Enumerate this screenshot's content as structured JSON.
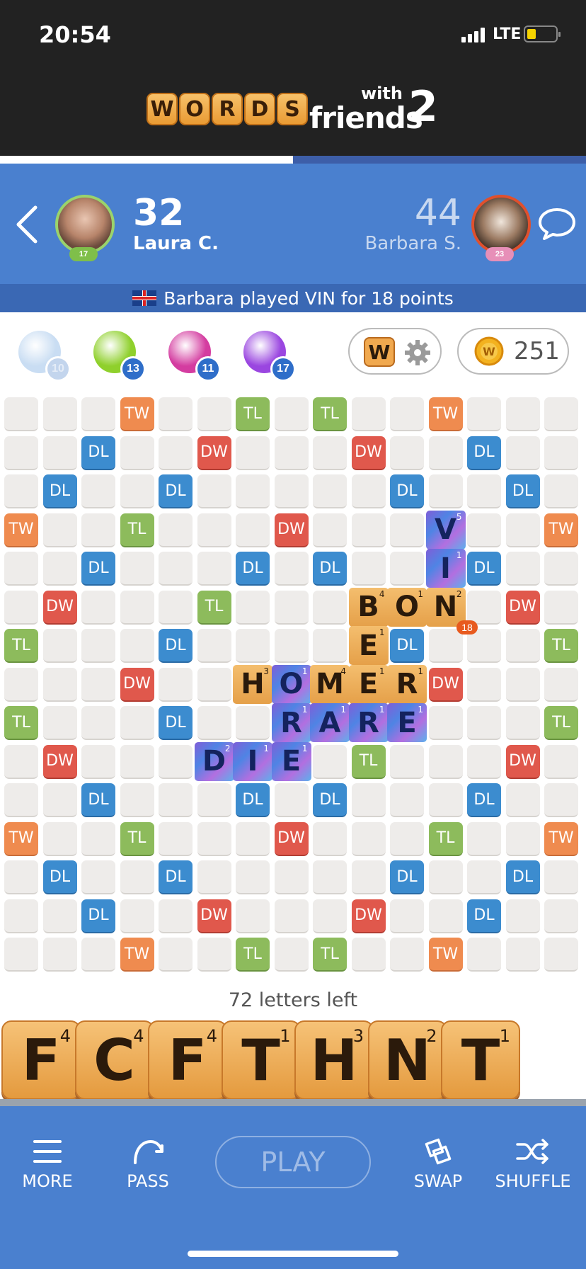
{
  "status": {
    "time": "20:54",
    "network": "LTE"
  },
  "logo": {
    "letters": [
      "W",
      "O",
      "R",
      "D",
      "S"
    ],
    "with": "with",
    "friends": "friends",
    "two": "2"
  },
  "match_progress": 0.5,
  "player": {
    "score": "32",
    "name": "Laura  C.",
    "level": "17"
  },
  "opponent": {
    "score": "44",
    "name": "Barbara S.",
    "level": "23"
  },
  "last_play": "Barbara played VIN for 18 points",
  "powerups": [
    {
      "name": "hindsight-icon",
      "count": "10",
      "color": "#b7d2ef"
    },
    {
      "name": "word-radar-icon",
      "count": "13",
      "color": "#8fd02c"
    },
    {
      "name": "swap-plus-icon",
      "count": "11",
      "color": "#d43ca0"
    },
    {
      "name": "word-strength-icon",
      "count": "17",
      "color": "#9a46e0"
    }
  ],
  "settings_pill": {
    "letter": "W"
  },
  "coins": "251",
  "board": {
    "bonus_rows": [
      [
        "",
        "",
        "",
        "TW",
        "",
        "",
        "TL",
        "",
        "TL",
        "",
        "",
        "TW",
        "",
        "",
        ""
      ],
      [
        "",
        "",
        "DL",
        "",
        "",
        "DW",
        "",
        "",
        "",
        "DW",
        "",
        "",
        "DL",
        "",
        ""
      ],
      [
        "",
        "DL",
        "",
        "",
        "DL",
        "",
        "",
        "",
        "",
        "",
        "DL",
        "",
        "",
        "DL",
        ""
      ],
      [
        "TW",
        "",
        "",
        "TL",
        "",
        "",
        "",
        "DW",
        "",
        "",
        "",
        "",
        "",
        "",
        "TW"
      ],
      [
        "",
        "",
        "DL",
        "",
        "",
        "",
        "DL",
        "",
        "DL",
        "",
        "",
        "",
        "DL",
        "",
        ""
      ],
      [
        "",
        "DW",
        "",
        "",
        "",
        "TL",
        "",
        "",
        "",
        "",
        "",
        "",
        "",
        "DW",
        ""
      ],
      [
        "TL",
        "",
        "",
        "",
        "DL",
        "",
        "",
        "",
        "",
        "",
        "DL",
        "",
        "",
        "",
        "TL"
      ],
      [
        "",
        "",
        "",
        "DW",
        "",
        "",
        "",
        "",
        "",
        "",
        "",
        "DW",
        "",
        "",
        ""
      ],
      [
        "TL",
        "",
        "",
        "",
        "DL",
        "",
        "",
        "",
        "",
        "",
        "",
        "",
        "",
        "",
        "TL"
      ],
      [
        "",
        "DW",
        "",
        "",
        "",
        "",
        "",
        "",
        "",
        "TL",
        "",
        "",
        "",
        "DW",
        ""
      ],
      [
        "",
        "",
        "DL",
        "",
        "",
        "",
        "DL",
        "",
        "DL",
        "",
        "",
        "",
        "DL",
        "",
        ""
      ],
      [
        "TW",
        "",
        "",
        "TL",
        "",
        "",
        "",
        "DW",
        "",
        "",
        "",
        "TL",
        "",
        "",
        "TW"
      ],
      [
        "",
        "DL",
        "",
        "",
        "DL",
        "",
        "",
        "",
        "",
        "",
        "DL",
        "",
        "",
        "DL",
        ""
      ],
      [
        "",
        "",
        "DL",
        "",
        "",
        "DW",
        "",
        "",
        "",
        "DW",
        "",
        "",
        "DL",
        "",
        ""
      ],
      [
        "",
        "",
        "",
        "TW",
        "",
        "",
        "TL",
        "",
        "TL",
        "",
        "",
        "TW",
        "",
        "",
        ""
      ]
    ],
    "tiles": [
      {
        "r": 3,
        "c": 11,
        "letter": "V",
        "value": "5",
        "recent": true
      },
      {
        "r": 4,
        "c": 11,
        "letter": "I",
        "value": "1",
        "recent": true
      },
      {
        "r": 5,
        "c": 9,
        "letter": "B",
        "value": "4",
        "recent": false
      },
      {
        "r": 5,
        "c": 10,
        "letter": "O",
        "value": "1",
        "recent": false
      },
      {
        "r": 5,
        "c": 11,
        "letter": "N",
        "value": "2",
        "recent": false
      },
      {
        "r": 6,
        "c": 9,
        "letter": "E",
        "value": "1",
        "recent": false
      },
      {
        "r": 7,
        "c": 6,
        "letter": "H",
        "value": "3",
        "recent": false
      },
      {
        "r": 7,
        "c": 7,
        "letter": "O",
        "value": "1",
        "recent": true
      },
      {
        "r": 7,
        "c": 8,
        "letter": "M",
        "value": "4",
        "recent": false
      },
      {
        "r": 7,
        "c": 9,
        "letter": "E",
        "value": "1",
        "recent": false
      },
      {
        "r": 7,
        "c": 10,
        "letter": "R",
        "value": "1",
        "recent": false
      },
      {
        "r": 8,
        "c": 7,
        "letter": "R",
        "value": "1",
        "recent": true
      },
      {
        "r": 8,
        "c": 8,
        "letter": "A",
        "value": "1",
        "recent": true
      },
      {
        "r": 8,
        "c": 9,
        "letter": "R",
        "value": "1",
        "recent": true
      },
      {
        "r": 8,
        "c": 10,
        "letter": "E",
        "value": "1",
        "recent": true
      },
      {
        "r": 9,
        "c": 5,
        "letter": "D",
        "value": "2",
        "recent": true
      },
      {
        "r": 9,
        "c": 6,
        "letter": "I",
        "value": "1",
        "recent": true
      },
      {
        "r": 9,
        "c": 7,
        "letter": "E",
        "value": "1",
        "recent": true
      }
    ],
    "last_play_points": "18"
  },
  "letters_left": "72 letters left",
  "rack": [
    {
      "letter": "F",
      "value": "4"
    },
    {
      "letter": "C",
      "value": "4"
    },
    {
      "letter": "F",
      "value": "4"
    },
    {
      "letter": "T",
      "value": "1"
    },
    {
      "letter": "H",
      "value": "3"
    },
    {
      "letter": "N",
      "value": "2"
    },
    {
      "letter": "T",
      "value": "1"
    }
  ],
  "actions": {
    "more": "MORE",
    "pass": "PASS",
    "play": "PLAY",
    "swap": "SWAP",
    "shuffle": "SHUFFLE"
  }
}
